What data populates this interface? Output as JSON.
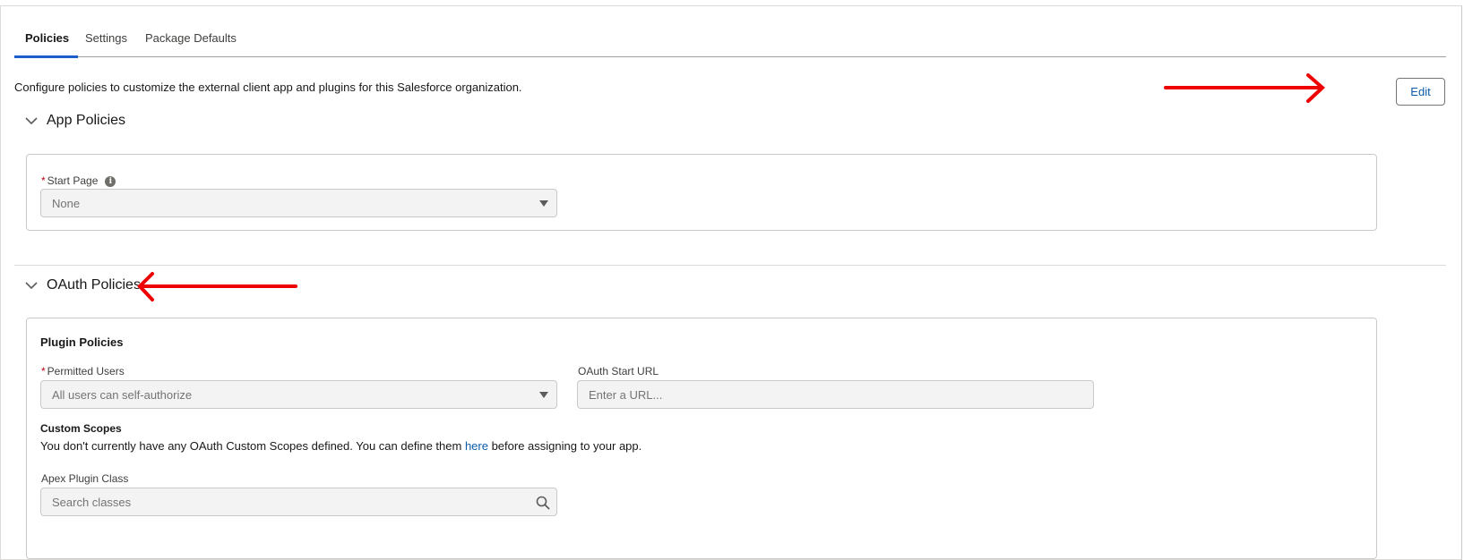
{
  "tabs": [
    {
      "label": "Policies",
      "active": true
    },
    {
      "label": "Settings",
      "active": false
    },
    {
      "label": "Package Defaults",
      "active": false
    }
  ],
  "description": "Configure policies to customize the external client app and plugins for this Salesforce organization.",
  "edit_button": "Edit",
  "app_policies": {
    "title": "App Policies",
    "start_page": {
      "label": "Start Page",
      "required_mark": "*",
      "info_icon": "info-icon",
      "value": "None"
    }
  },
  "oauth_policies": {
    "title": "OAuth Policies",
    "plugin_policies_heading": "Plugin Policies",
    "permitted_users": {
      "label": "Permitted Users",
      "required_mark": "*",
      "value": "All users can self-authorize"
    },
    "oauth_start_url": {
      "label": "OAuth Start URL",
      "placeholder": "Enter a URL..."
    },
    "custom_scopes": {
      "heading": "Custom Scopes",
      "text_before": "You don't currently have any OAuth Custom Scopes defined. You can define them ",
      "link": "here",
      "text_after": " before assigning to your app."
    },
    "apex_plugin_class": {
      "label": "Apex Plugin Class",
      "placeholder": "Search classes"
    }
  },
  "colors": {
    "accent": "#1b5ecc",
    "link": "#0b5cab",
    "required": "#ba0517",
    "annotation_arrow": "#ee0000"
  }
}
